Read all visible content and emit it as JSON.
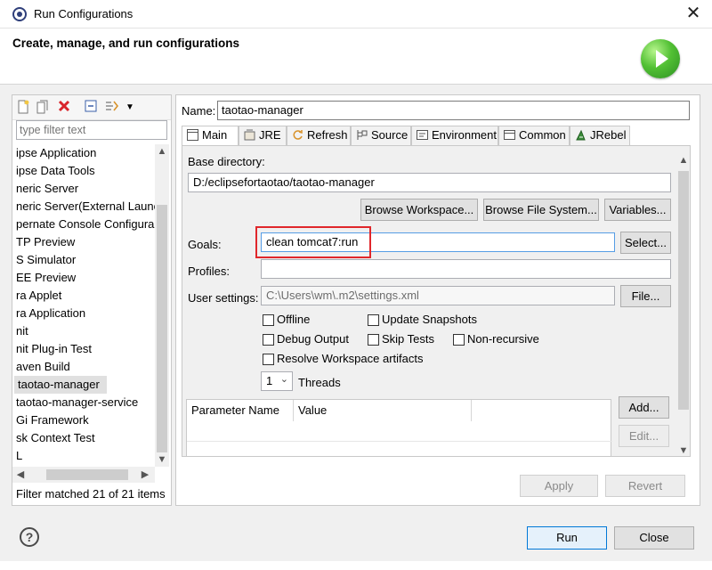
{
  "window": {
    "title": "Run Configurations",
    "close_glyph": "✕"
  },
  "header": {
    "title": "Create, manage, and run configurations",
    "icon": "run-green-icon"
  },
  "sidebar": {
    "toolbar_icons": [
      "new-config-icon",
      "duplicate-icon",
      "delete-icon",
      "collapse-all-icon",
      "filter-icon",
      "dropdown-icon"
    ],
    "filter_placeholder": "type filter text",
    "items": [
      {
        "label": "ipse Application"
      },
      {
        "label": "ipse Data Tools"
      },
      {
        "label": "neric Server"
      },
      {
        "label": "neric Server(External Launc"
      },
      {
        "label": "pernate Console Configura"
      },
      {
        "label": "TP Preview"
      },
      {
        "label": "S Simulator"
      },
      {
        "label": "EE Preview"
      },
      {
        "label": "ra Applet"
      },
      {
        "label": "ra Application"
      },
      {
        "label": "nit"
      },
      {
        "label": "nit Plug-in Test"
      },
      {
        "label": "aven Build"
      },
      {
        "label": "taotao-manager",
        "selected": true
      },
      {
        "label": "taotao-manager-service"
      },
      {
        "label": "Gi Framework"
      },
      {
        "label": "sk Context Test"
      },
      {
        "label": "L"
      }
    ],
    "filter_status": "Filter matched 21 of 21 items"
  },
  "main": {
    "name_label": "Name:",
    "name_value": "taotao-manager",
    "tabs": [
      {
        "label": "Main",
        "icon": "main-tab-icon",
        "active": true
      },
      {
        "label": "JRE",
        "icon": "jre-icon"
      },
      {
        "label": "Refresh",
        "icon": "refresh-icon"
      },
      {
        "label": "Source",
        "icon": "source-icon"
      },
      {
        "label": "Environment",
        "icon": "environment-icon"
      },
      {
        "label": "Common",
        "icon": "common-icon"
      },
      {
        "label": "JRebel",
        "icon": "jrebel-icon"
      }
    ],
    "base_dir_label": "Base directory:",
    "base_dir_value": "D:/eclipsefortaotao/taotao-manager",
    "browse_workspace": "Browse Workspace...",
    "browse_fs": "Browse File System...",
    "variables": "Variables...",
    "goals_label": "Goals:",
    "goals_value": "clean tomcat7:run",
    "select": "Select...",
    "profiles_label": "Profiles:",
    "profiles_value": "",
    "user_settings_label": "User settings:",
    "user_settings_value": "C:\\Users\\wm\\.m2\\settings.xml",
    "file_btn": "File...",
    "checkboxes": {
      "offline": "Offline",
      "update_snapshots": "Update Snapshots",
      "debug_output": "Debug Output",
      "skip_tests": "Skip Tests",
      "non_recursive": "Non-recursive",
      "resolve_ws": "Resolve Workspace artifacts"
    },
    "threads_value": "1",
    "threads_label": "Threads",
    "param_headers": [
      "Parameter Name",
      "Value"
    ],
    "add_btn": "Add...",
    "edit_btn": "Edit...",
    "apply_btn": "Apply",
    "revert_btn": "Revert"
  },
  "footer": {
    "help": "?",
    "run": "Run",
    "close": "Close"
  },
  "colors": {
    "highlight": "#e0272b",
    "default_button_border": "#0078d7"
  }
}
